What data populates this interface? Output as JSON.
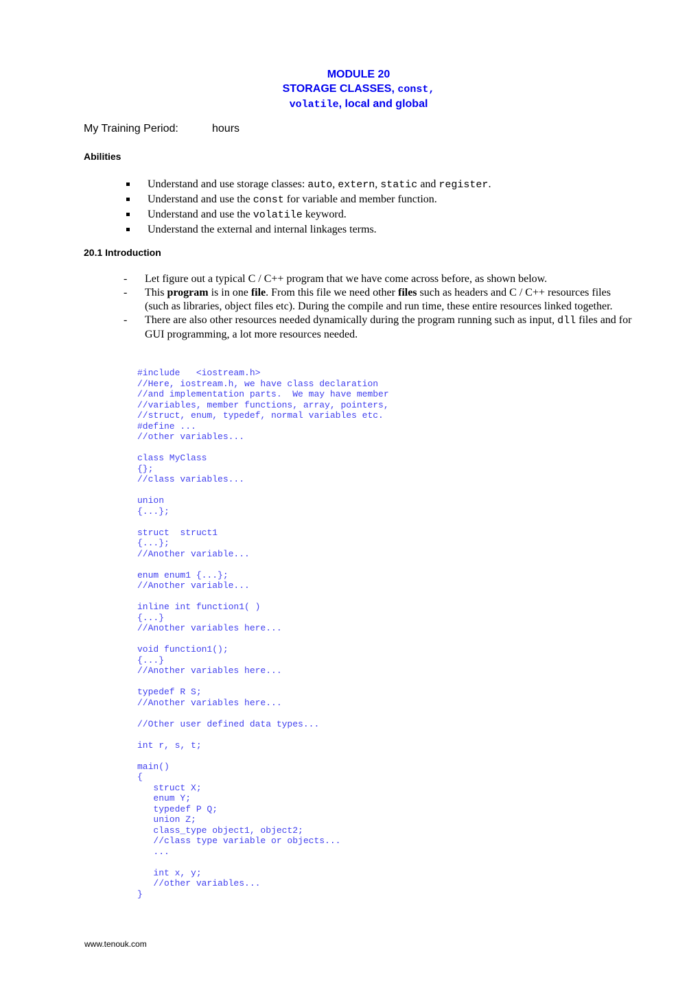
{
  "title": {
    "line1": "MODULE 20",
    "line2_text": "STORAGE CLASSES, ",
    "line2_code": "const,",
    "line3_code": "volatile",
    "line3_text": ", local and global"
  },
  "training_period": {
    "label": "My Training Period:",
    "value": "hours"
  },
  "abilities": {
    "heading": "Abilities",
    "items": [
      {
        "parts": [
          {
            "t": "Understand and use storage classes: "
          },
          {
            "c": "auto"
          },
          {
            "t": ", "
          },
          {
            "c": "extern"
          },
          {
            "t": ", "
          },
          {
            "c": "static"
          },
          {
            "t": " and "
          },
          {
            "c": "register"
          },
          {
            "t": "."
          }
        ]
      },
      {
        "parts": [
          {
            "t": "Understand and use the "
          },
          {
            "c": "const"
          },
          {
            "t": " for variable and member function."
          }
        ]
      },
      {
        "parts": [
          {
            "t": "Understand and use the "
          },
          {
            "c": "volatile"
          },
          {
            "t": " keyword."
          }
        ]
      },
      {
        "parts": [
          {
            "t": "Understand the external and internal linkages terms."
          }
        ]
      }
    ]
  },
  "section": {
    "heading": "20.1  Introduction",
    "bullets": [
      {
        "parts": [
          {
            "t": "Let figure out a typical C / C++ program that we have come across before, as shown below."
          }
        ]
      },
      {
        "parts": [
          {
            "t": "This "
          },
          {
            "b": "program"
          },
          {
            "t": " is in one "
          },
          {
            "b": "file"
          },
          {
            "t": ".  From this file we need other "
          },
          {
            "b": "files"
          },
          {
            "t": " such as headers and C / C++ resources files (such as libraries, object files etc).  During the compile and run time, these entire resources linked together."
          }
        ]
      },
      {
        "parts": [
          {
            "t": "There are also other resources needed dynamically during the program running such as input, "
          },
          {
            "c": "dll"
          },
          {
            "t": " files and for GUI programming, a lot more resources needed."
          }
        ]
      }
    ],
    "code_lines": [
      "#include   <iostream.h>",
      "//Here, iostream.h, we have class declaration",
      "//and implementation parts.  We may have member",
      "//variables, member functions, array, pointers,",
      "//struct, enum, typedef, normal variables etc.",
      "#define ...",
      "//other variables...",
      "",
      "class MyClass",
      "{};",
      "//class variables...",
      "",
      "union",
      "{...};",
      "",
      "struct  struct1",
      "{...};",
      "//Another variable...",
      "",
      "enum enum1 {...};",
      "//Another variable...",
      "",
      "inline int function1( )",
      "{...}",
      "//Another variables here...",
      "",
      "void function1();",
      "{...}",
      "//Another variables here...",
      "",
      "typedef R S;",
      "//Another variables here...",
      "",
      "//Other user defined data types...",
      "",
      "int r, s, t;",
      "",
      "main()",
      "{",
      "   struct X;",
      "   enum Y;",
      "   typedef P Q;",
      "   union Z;",
      "   class_type object1, object2;",
      "   //class type variable or objects...",
      "   ...",
      "",
      "   int x, y;",
      "   //other variables...",
      "}"
    ]
  },
  "footer": {
    "link": "www.tenouk.com"
  },
  "colors": {
    "title": "#0000ee",
    "code": "#4040ee",
    "text": "#000000"
  }
}
